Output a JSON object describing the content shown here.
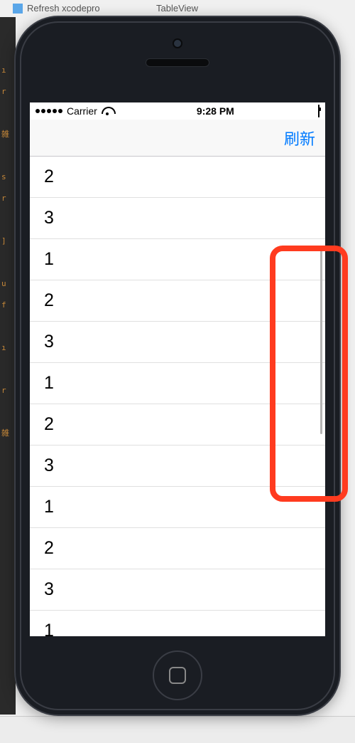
{
  "xcode": {
    "tab1_label": "Refresh xcodepro",
    "tab2_label": "TableView"
  },
  "status_bar": {
    "carrier": "Carrier",
    "time": "9:28 PM"
  },
  "nav_bar": {
    "refresh_button": "刷新"
  },
  "table": {
    "rows": [
      "2",
      "3",
      "1",
      "2",
      "3",
      "1",
      "2",
      "3",
      "1",
      "2",
      "3",
      "1"
    ]
  }
}
